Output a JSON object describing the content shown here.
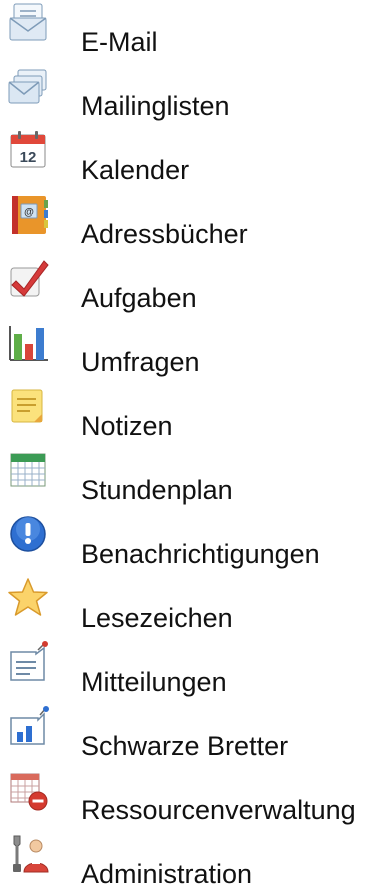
{
  "menu": {
    "items": [
      {
        "label": "E-Mail",
        "icon": "email-icon"
      },
      {
        "label": "Mailinglisten",
        "icon": "mailing-lists-icon"
      },
      {
        "label": "Kalender",
        "icon": "calendar-icon",
        "calendar_day": "12"
      },
      {
        "label": "Adressbücher",
        "icon": "address-book-icon"
      },
      {
        "label": "Aufgaben",
        "icon": "task-check-icon"
      },
      {
        "label": "Umfragen",
        "icon": "poll-chart-icon"
      },
      {
        "label": "Notizen",
        "icon": "notes-icon"
      },
      {
        "label": "Stundenplan",
        "icon": "timetable-icon"
      },
      {
        "label": "Benachrichtigungen",
        "icon": "notification-icon"
      },
      {
        "label": "Lesezeichen",
        "icon": "bookmark-star-icon"
      },
      {
        "label": "Mitteilungen",
        "icon": "messages-icon"
      },
      {
        "label": "Schwarze Bretter",
        "icon": "bulletin-board-icon"
      },
      {
        "label": "Ressourcenverwaltung",
        "icon": "resource-management-icon"
      },
      {
        "label": "Administration",
        "icon": "administration-icon"
      }
    ]
  }
}
